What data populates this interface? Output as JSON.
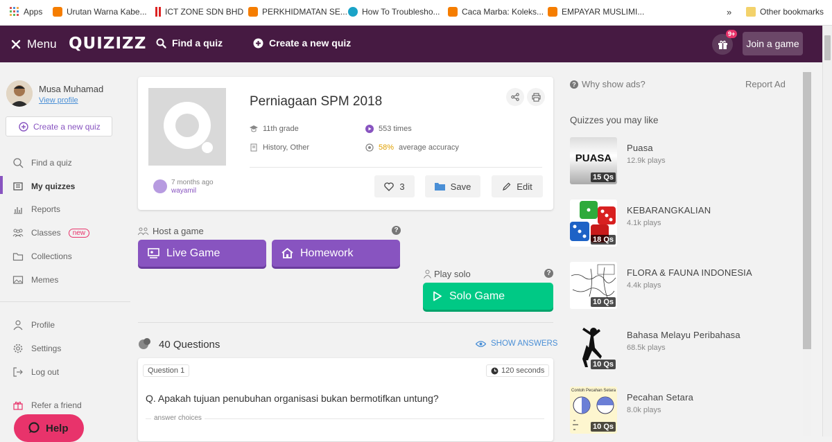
{
  "bookmarks": {
    "items": [
      {
        "label": "Apps",
        "icon": "apps-grid-icon"
      },
      {
        "label": "Urutan Warna Kabe...",
        "icon": "blogger-icon"
      },
      {
        "label": "ICT ZONE SDN BHD",
        "icon": "ict-zone-icon"
      },
      {
        "label": "PERKHIDMATAN SE...",
        "icon": "blogger-icon"
      },
      {
        "label": "How To Troublesho...",
        "icon": "site-icon"
      },
      {
        "label": "Caca Marba: Koleks...",
        "icon": "blogger-icon"
      },
      {
        "label": "EMPAYAR MUSLIMI...",
        "icon": "blogger-icon"
      }
    ],
    "overflow": "»",
    "other": "Other bookmarks"
  },
  "nav": {
    "menu": "Menu",
    "logo": "QUIZIZZ",
    "find": "Find a quiz",
    "create": "Create a new quiz",
    "notif_count": "9+",
    "join": "Join a game"
  },
  "sidebar": {
    "user_name": "Musa Muhamad",
    "view_profile": "View profile",
    "create_btn": "Create a new quiz",
    "items": [
      {
        "label": "Find a quiz",
        "icon": "search-icon"
      },
      {
        "label": "My quizzes",
        "icon": "my-quizzes-icon",
        "active": true
      },
      {
        "label": "Reports",
        "icon": "reports-icon"
      },
      {
        "label": "Classes",
        "icon": "classes-icon",
        "badge": "new"
      },
      {
        "label": "Collections",
        "icon": "folder-icon"
      },
      {
        "label": "Memes",
        "icon": "image-icon"
      }
    ],
    "items2": [
      {
        "label": "Profile",
        "icon": "user-icon"
      },
      {
        "label": "Settings",
        "icon": "gear-icon"
      },
      {
        "label": "Log out",
        "icon": "logout-icon"
      },
      {
        "label": "Refer a friend",
        "icon": "gift-icon"
      }
    ],
    "help": "Help"
  },
  "quiz": {
    "title": "Perniagaan SPM 2018",
    "grade": "11th grade",
    "played": "553 times",
    "subjects": "History, Other",
    "accuracy": "58%",
    "accuracy_label": "average accuracy",
    "ago": "7 months ago",
    "author": "wayamil",
    "likes": "3",
    "save": "Save",
    "edit": "Edit"
  },
  "host": {
    "label": "Host a game",
    "live": "Live Game",
    "homework": "Homework",
    "solo_label": "Play solo",
    "solo": "Solo Game"
  },
  "questions": {
    "count": "40 Questions",
    "show_answers": "SHOW ANSWERS",
    "q1": {
      "num": "Question 1",
      "time": "120 seconds",
      "text": "Q. Apakah tujuan penubuhan organisasi bukan bermotifkan untung?",
      "choices_label": "answer choices"
    }
  },
  "right": {
    "why_ads": "Why show ads?",
    "report_ad": "Report Ad",
    "heading": "Quizzes you may like",
    "quizzes": [
      {
        "title": "Puasa",
        "plays": "12.9k plays",
        "qs": "15 Qs",
        "thumb_text": "PUASA"
      },
      {
        "title": "KEBARANGKALIAN",
        "plays": "4.1k plays",
        "qs": "18 Qs"
      },
      {
        "title": "FLORA & FAUNA INDONESIA",
        "plays": "4.4k plays",
        "qs": "10 Qs"
      },
      {
        "title": "Bahasa Melayu Peribahasa",
        "plays": "68.5k plays",
        "qs": "10 Qs"
      },
      {
        "title": "Pecahan Setara",
        "plays": "8.0k plays",
        "qs": "10 Qs",
        "thumb_text": "Contoh Pecahan Setara"
      }
    ]
  },
  "colors": {
    "nav": "#461a42",
    "purple_btn": "#8854c0",
    "green_btn": "#00c985",
    "accent_blue": "#4a8fd6"
  }
}
